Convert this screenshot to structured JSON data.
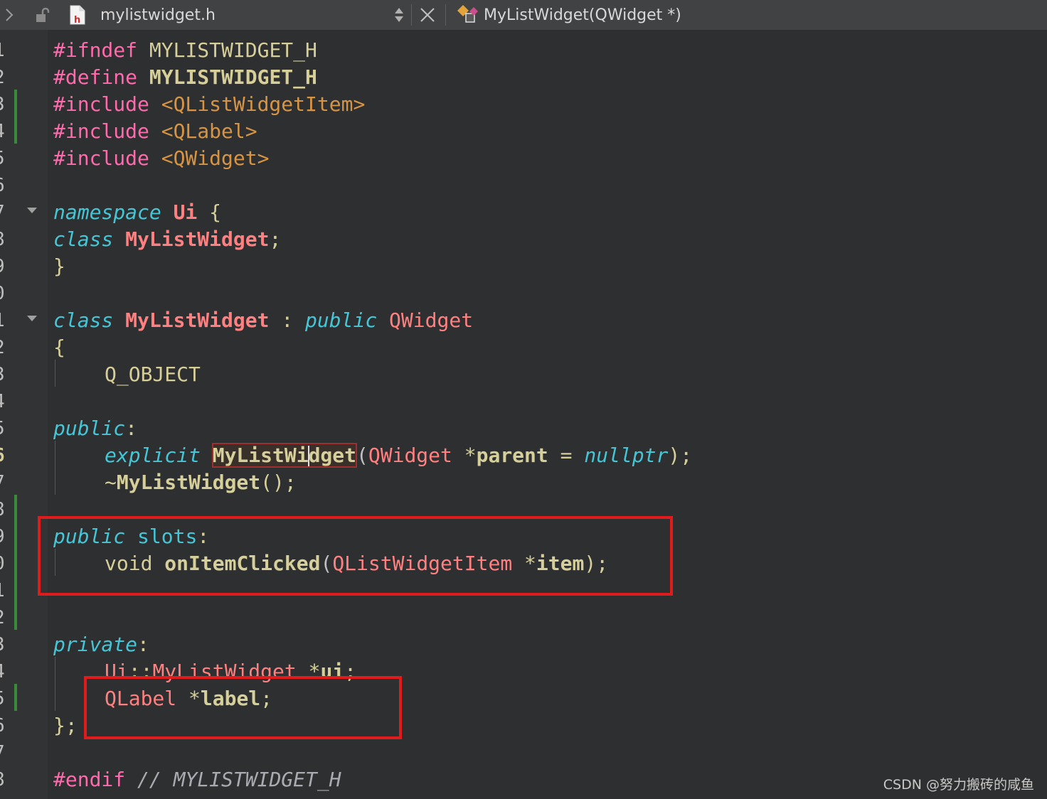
{
  "tab_bar": {
    "filename": "mylistwidget.h",
    "file_icon_letter": "h",
    "current_symbol": "MyListWidget(QWidget *)"
  },
  "gutter": {
    "line_numbers": [
      "1",
      "2",
      "3",
      "4",
      "5",
      "6",
      "7",
      "8",
      "9",
      "0",
      "1",
      "2",
      "3",
      "4",
      "5",
      "6",
      "7",
      "8",
      "9",
      "0",
      "1",
      "2",
      "3",
      "4",
      "5",
      "6",
      "7",
      "8"
    ],
    "current_line_index": 15
  },
  "code": {
    "l1": {
      "directive": "#ifndef",
      "macro": "MYLISTWIDGET_H"
    },
    "l2": {
      "directive": "#define",
      "macro": "MYLISTWIDGET_H"
    },
    "l3": {
      "directive": "#include",
      "header": "<QListWidgetItem>"
    },
    "l4": {
      "directive": "#include",
      "header": "<QLabel>"
    },
    "l5": {
      "directive": "#include",
      "header": "<QWidget>"
    },
    "l7": {
      "kw": "namespace",
      "name": "Ui",
      "brace": "{"
    },
    "l8": {
      "kw": "class",
      "name": "MyListWidget",
      "semi": ";"
    },
    "l9": {
      "brace": "}"
    },
    "l11": {
      "kw": "class",
      "name": "MyListWidget",
      "colon": ":",
      "access": "public",
      "base": "QWidget"
    },
    "l12": {
      "brace": "{"
    },
    "l13": {
      "macro": "Q_OBJECT"
    },
    "l15": {
      "access": "public",
      "colon": ":"
    },
    "l16": {
      "kw": "explicit",
      "name_a": "MyListWi",
      "name_b": "dget",
      "paren_open": "(",
      "type": "QWidget",
      "ptr": "*",
      "param": "parent",
      "eq": "=",
      "default": "nullptr",
      "tail": ");"
    },
    "l17": {
      "tilde": "~",
      "name": "MyListWidget",
      "tail": "();"
    },
    "l19": {
      "access": "public",
      "slots": "slots",
      "colon": ":"
    },
    "l20": {
      "ret": "void",
      "name": "onItemClicked",
      "paren_open": "(",
      "type": "QListWidgetItem",
      "ptr": "*",
      "param": "item",
      "tail": ");"
    },
    "l23": {
      "access": "private",
      "colon": ":"
    },
    "l24": {
      "ns": "Ui",
      "scope": "::",
      "type": "MyListWidget",
      "ptr": "*",
      "name": "ui",
      "semi": ";"
    },
    "l25": {
      "type": "QLabel",
      "ptr": "*",
      "name": "label",
      "semi": ";"
    },
    "l26": {
      "close": "};"
    },
    "l28": {
      "directive": "#endif",
      "comment": "// MYLISTWIDGET_H"
    }
  },
  "watermark": "CSDN @努力搬砖的咸鱼",
  "colors": {
    "background": "#2e2f30",
    "gutter": "#313335",
    "preprocessor": "#ff6aad",
    "keyword": "#45c6d6",
    "type": "#ff8080",
    "include_path": "#d69545",
    "annotation_box": "#e01b1b",
    "change_marker": "#3a8a3a"
  }
}
